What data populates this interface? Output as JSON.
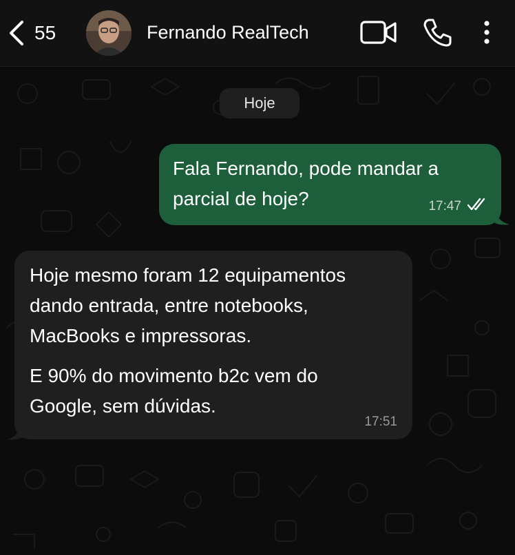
{
  "header": {
    "back_count": "55",
    "contact_name": "Fernando RealTech",
    "icons": [
      "chevron-left-icon",
      "video-call-icon",
      "phone-icon",
      "more-vertical-icon"
    ]
  },
  "date_separator": "Hoje",
  "messages": [
    {
      "direction": "outgoing",
      "lines": [
        "Fala Fernando, pode mandar a",
        "parcial de hoje?"
      ],
      "time": "17:47",
      "status": "read"
    },
    {
      "direction": "incoming",
      "paragraphs": [
        [
          "Hoje mesmo foram 12 equipamentos",
          "dando entrada, entre notebooks,",
          "MacBooks e impressoras."
        ],
        [
          "E 90% do movimento b2c vem do",
          "Google, sem dúvidas."
        ]
      ],
      "time": "17:51"
    }
  ],
  "colors": {
    "outgoing_bubble": "#1c5f3a",
    "incoming_bubble": "#1f1f1f",
    "header_bg": "#121212",
    "read_ticks": "#ffffff"
  }
}
